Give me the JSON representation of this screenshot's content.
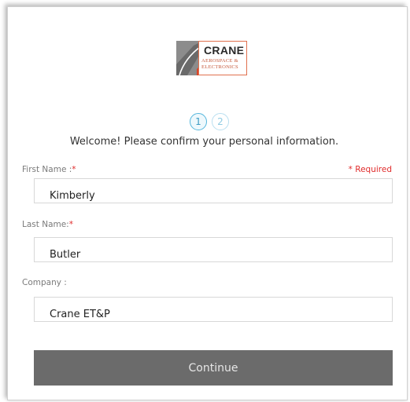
{
  "brand": {
    "name": "CRANE",
    "subtitle_line1": "AEROSPACE &",
    "subtitle_line2": "ELECTRONICS"
  },
  "steps": [
    {
      "label": "1",
      "active": true
    },
    {
      "label": "2",
      "active": false
    }
  ],
  "welcome_text": "Welcome! Please confirm your personal information.",
  "required_note": "* Required",
  "form": {
    "first_name": {
      "label": "First Name :",
      "required_mark": "*",
      "value": "Kimberly"
    },
    "last_name": {
      "label": "Last Name:",
      "required_mark": "*",
      "value": "Butler"
    },
    "company": {
      "label": "Company :",
      "value": "Crane ET&P"
    }
  },
  "continue_label": "Continue",
  "colors": {
    "accent": "#55b6dc",
    "required": "#e02b2b",
    "button": "#6b6b6b",
    "logo_orange": "#e0704e"
  }
}
